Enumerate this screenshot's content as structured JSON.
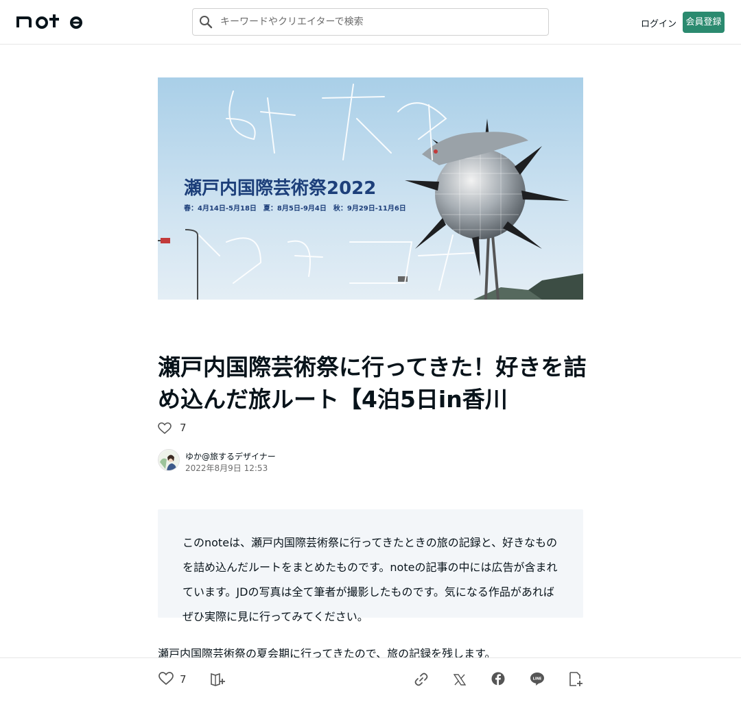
{
  "header": {
    "logo_text": "note",
    "search_placeholder": "キーワードやクリエイターで検索",
    "login_label": "ログイン",
    "signup_label": "会員登録"
  },
  "hero": {
    "banner_title": "瀬戸内国際芸術祭2022",
    "banner_dates": "春：4月14日-5月18日　夏：8月5日-9月4日　秋：9月29日-11月6日",
    "overlay_text_1": "好き",
    "overlay_text_2": "小豆島コース"
  },
  "article": {
    "title": "瀬戸内国際芸術祭に行ってきた！好きを詰め込んだ旅ルート【4泊5日in香川",
    "like_count": "7",
    "author_name": "ゆか@旅するデザイナー",
    "date": "2022年8月9日 12:53",
    "intro": "このnoteは、瀬戸内国際芸術祭に行ってきたときの旅の記録と、好きなものを詰め込んだルートをまとめたものです。noteの記事の中には広告が含まれています。JDの写真は全て筆者が撮影したものです。気になる作品があればぜひ実際に見に行ってみてください。",
    "body_first_line": "瀬戸内国際芸術祭の夏会期に行ってきたので、旅の記録を残します。"
  },
  "bottom_bar": {
    "like_count": "7"
  },
  "colors": {
    "accent": "#2b8a6f",
    "text": "#08131a",
    "intro_bg": "#f3f6f9"
  },
  "icons": [
    "search-icon",
    "heart-icon",
    "magazine-add-icon",
    "link-icon",
    "x-icon",
    "facebook-icon",
    "line-icon",
    "embed-icon"
  ]
}
